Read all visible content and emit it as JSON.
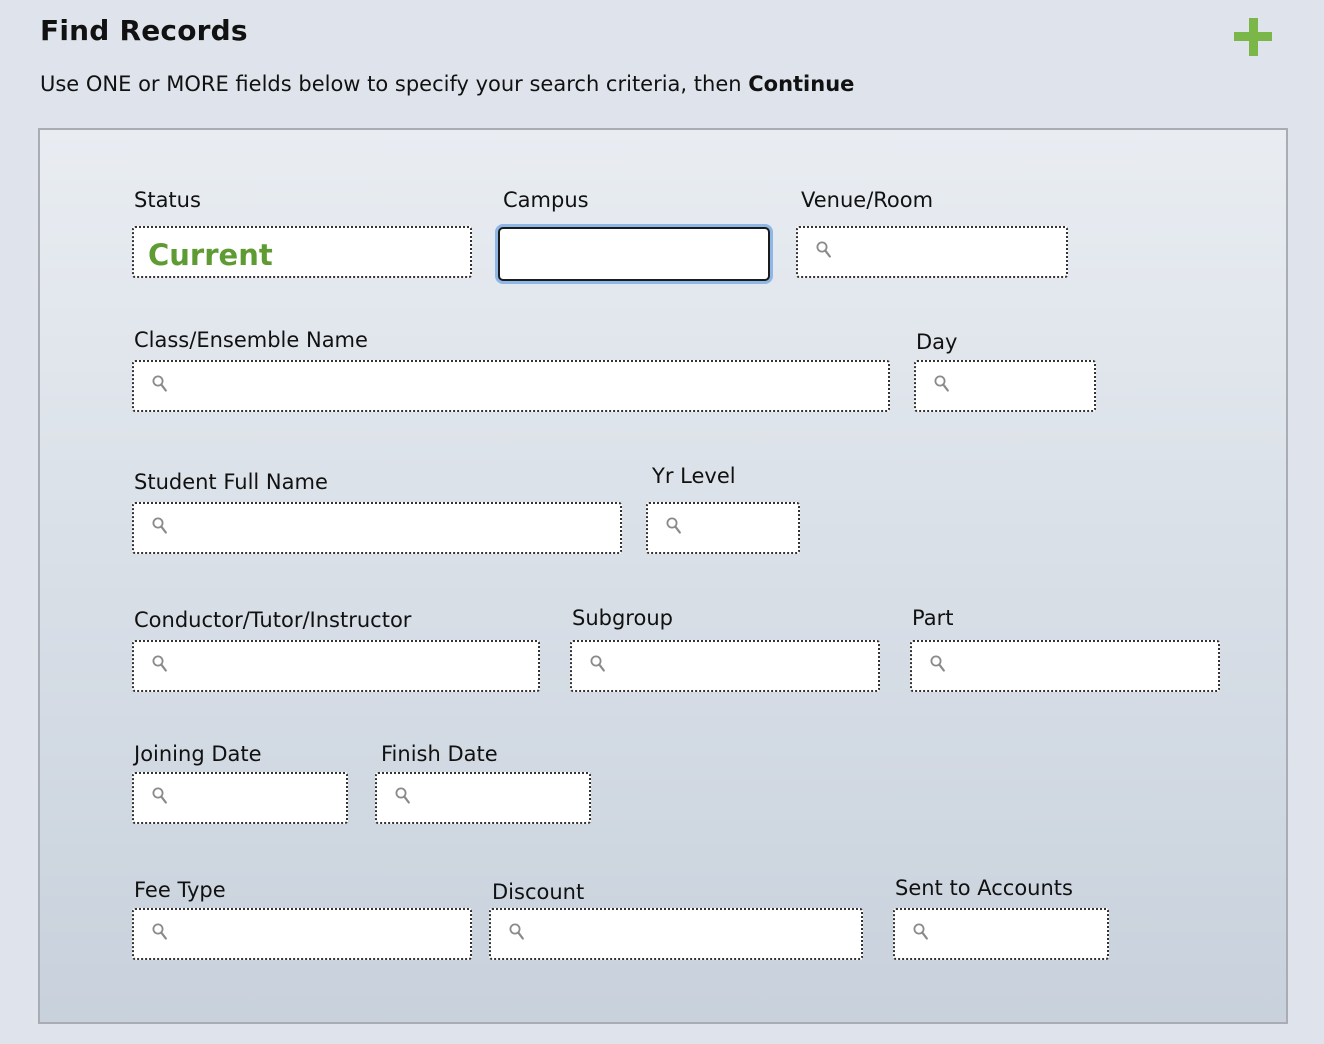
{
  "header": {
    "title": "Find Records",
    "instruction_prefix": "Use ONE or MORE fields below to specify your search criteria, then ",
    "instruction_bold": "Continue"
  },
  "colors": {
    "accent_green": "#7ab648",
    "status_text": "#5f9b33",
    "focus_ring": "#8fb7e6"
  },
  "icons": {
    "add": "plus-icon",
    "field": "search-icon"
  },
  "fields": {
    "status": {
      "label": "Status",
      "value": "Current"
    },
    "campus": {
      "label": "Campus",
      "value": ""
    },
    "venue": {
      "label": "Venue/Room",
      "value": ""
    },
    "class_name": {
      "label": "Class/Ensemble Name",
      "value": ""
    },
    "day": {
      "label": "Day",
      "value": ""
    },
    "student_name": {
      "label": "Student Full Name",
      "value": ""
    },
    "yr_level": {
      "label": "Yr Level",
      "value": ""
    },
    "conductor": {
      "label": "Conductor/Tutor/Instructor",
      "value": ""
    },
    "subgroup": {
      "label": "Subgroup",
      "value": ""
    },
    "part": {
      "label": "Part",
      "value": ""
    },
    "joining_date": {
      "label": "Joining Date",
      "value": ""
    },
    "finish_date": {
      "label": "Finish Date",
      "value": ""
    },
    "fee_type": {
      "label": "Fee Type",
      "value": ""
    },
    "discount": {
      "label": "Discount",
      "value": ""
    },
    "sent_to_accounts": {
      "label": "Sent to Accounts",
      "value": ""
    }
  }
}
